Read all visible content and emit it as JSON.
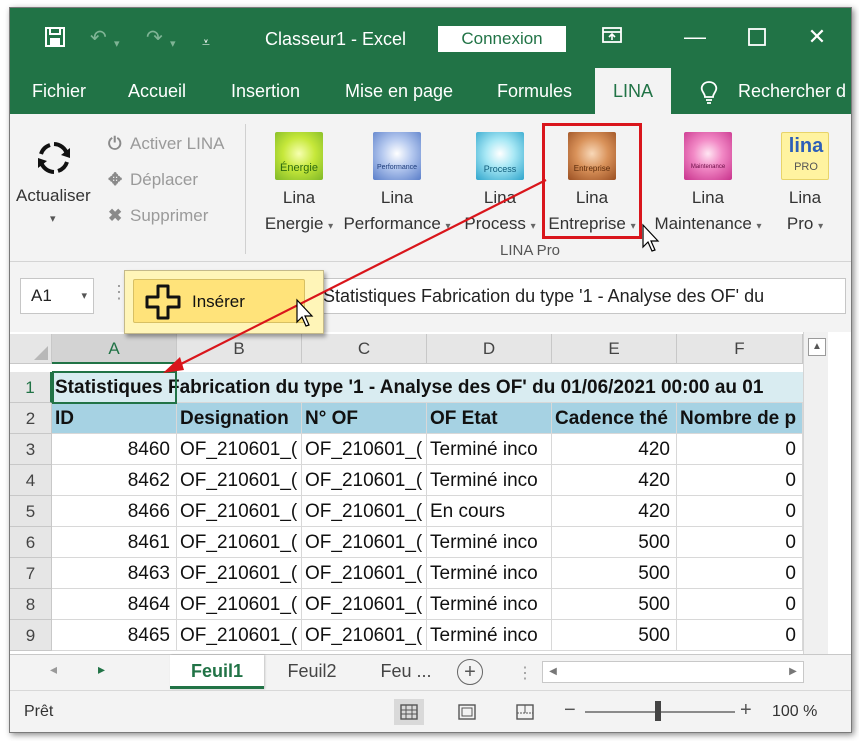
{
  "titlebar": {
    "title": "Classeur1  -  Excel",
    "signin_label": "Connexion",
    "icons": [
      "save-icon",
      "undo-icon",
      "redo-icon",
      "customize-icon",
      "ribbon-display-icon",
      "minimize-icon",
      "maximize-icon",
      "close-icon"
    ]
  },
  "tabs": {
    "fichier": "Fichier",
    "accueil": "Accueil",
    "insertion": "Insertion",
    "mise_en_page": "Mise en page",
    "formules": "Formules",
    "lina": "LINA",
    "search": "Rechercher d"
  },
  "ribbon": {
    "refresh_label": "Actualiser",
    "activer": "Activer LINA",
    "deplacer": "Déplacer",
    "supprimer": "Supprimer",
    "items": [
      {
        "line1": "Lina",
        "line2": "Energie",
        "icon_text": "Énergie"
      },
      {
        "line1": "Lina",
        "line2": "Performance",
        "icon_text": "Performance"
      },
      {
        "line1": "Lina",
        "line2": "Process",
        "icon_text": "Process"
      },
      {
        "line1": "Lina",
        "line2": "Entreprise",
        "icon_text": "Entreprise"
      },
      {
        "line1": "Lina",
        "line2": "Maintenance",
        "icon_text": "Maintenance"
      },
      {
        "line1": "Lina",
        "line2": "Pro",
        "icon_text": "lina",
        "icon_sub": "PRO"
      }
    ],
    "group_label": "LINA Pro",
    "accent": "#d9151b"
  },
  "formula_bar": {
    "cell_ref": "A1",
    "content": "Statistiques Fabrication du type '1 - Analyse des OF' du"
  },
  "popup": {
    "label": "Insérer"
  },
  "sheet": {
    "columns": [
      "A",
      "B",
      "C",
      "D",
      "E",
      "F"
    ],
    "row1": "Statistiques Fabrication du type '1 - Analyse des OF' du 01/06/2021 00:00 au 01",
    "headers": [
      "ID",
      "Designation",
      "N° OF",
      "OF Etat",
      "Cadence thé",
      "Nombre de p"
    ],
    "rows": [
      {
        "n": "3",
        "id": "8460",
        "des": "OF_210601_(",
        "of": "OF_210601_(",
        "etat": "Terminé inco",
        "cad": "420",
        "nb": "0"
      },
      {
        "n": "4",
        "id": "8462",
        "des": "OF_210601_(",
        "of": "OF_210601_(",
        "etat": "Terminé inco",
        "cad": "420",
        "nb": "0"
      },
      {
        "n": "5",
        "id": "8466",
        "des": "OF_210601_(",
        "of": "OF_210601_(",
        "etat": "En cours",
        "cad": "420",
        "nb": "0"
      },
      {
        "n": "6",
        "id": "8461",
        "des": "OF_210601_(",
        "of": "OF_210601_(",
        "etat": "Terminé inco",
        "cad": "500",
        "nb": "0"
      },
      {
        "n": "7",
        "id": "8463",
        "des": "OF_210601_(",
        "of": "OF_210601_(",
        "etat": "Terminé inco",
        "cad": "500",
        "nb": "0"
      },
      {
        "n": "8",
        "id": "8464",
        "des": "OF_210601_(",
        "of": "OF_210601_(",
        "etat": "Terminé inco",
        "cad": "500",
        "nb": "0"
      },
      {
        "n": "9",
        "id": "8465",
        "des": "OF_210601_(",
        "of": "OF_210601_(",
        "etat": "Terminé inco",
        "cad": "500",
        "nb": "0"
      }
    ],
    "row_numbers": [
      "1",
      "2"
    ]
  },
  "sheet_tabs": {
    "tabs": [
      "Feuil1",
      "Feuil2",
      "Feu ..."
    ],
    "active": "Feuil1"
  },
  "statusbar": {
    "status": "Prêt",
    "zoom": "100 %"
  },
  "colors": {
    "excel_green": "#217346",
    "header_row": "#a6d2e3",
    "title_row": "#d9ecf1"
  }
}
